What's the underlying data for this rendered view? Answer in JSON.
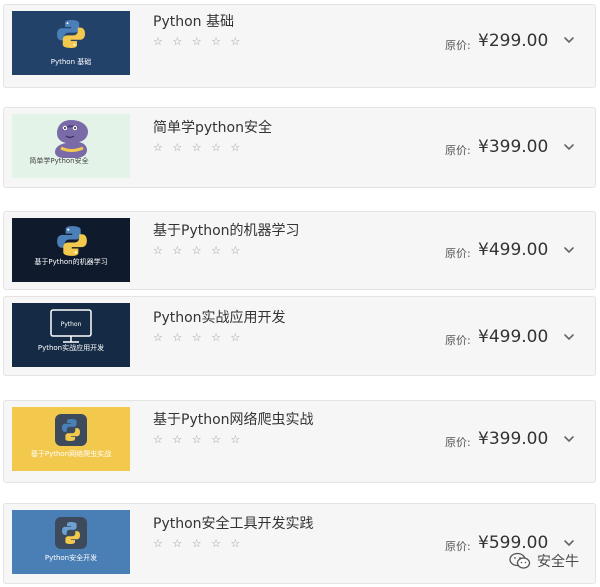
{
  "courses": [
    {
      "title": "Python 基础",
      "stars": "☆ ☆ ☆ ☆ ☆",
      "price_label": "原价:",
      "price": "¥299.00",
      "thumb_caption": "Python 基础",
      "thumb_bg": "#22426a",
      "thumb_fg": "#ffffff",
      "thumb_icon": "python-logo-icon"
    },
    {
      "title": "简单学python安全",
      "stars": "☆ ☆ ☆ ☆ ☆",
      "price_label": "原价:",
      "price": "¥399.00",
      "thumb_caption": "简单学Python安全",
      "thumb_bg": "#e4f3e8",
      "thumb_fg": "#444444",
      "thumb_icon": "python-snake-mascot-icon"
    },
    {
      "title": "基于Python的机器学习",
      "stars": "☆ ☆ ☆ ☆ ☆",
      "price_label": "原价:",
      "price": "¥499.00",
      "thumb_caption": "基于Python的机器学习",
      "thumb_bg": "#0f1a2c",
      "thumb_fg": "#ffffff",
      "thumb_icon": "python-logo-icon"
    },
    {
      "title": "Python实战应用开发",
      "stars": "☆ ☆ ☆ ☆ ☆",
      "price_label": "原价:",
      "price": "¥499.00",
      "thumb_caption": "Python实战应用开发",
      "thumb_screen_text": "Python",
      "thumb_bg": "#152b45",
      "thumb_fg": "#ffffff",
      "thumb_icon": "monitor-icon"
    },
    {
      "title": "基于Python网络爬虫实战",
      "stars": "☆ ☆ ☆ ☆ ☆",
      "price_label": "原价:",
      "price": "¥399.00",
      "thumb_caption": "基于Python网络爬虫实战",
      "thumb_bg": "#f2c94c",
      "thumb_fg": "#ffffff",
      "thumb_icon": "python-badge-icon"
    },
    {
      "title": "Python安全工具开发实践",
      "stars": "☆ ☆ ☆ ☆ ☆",
      "price_label": "原价:",
      "price": "¥599.00",
      "thumb_caption": "Python安全开发",
      "thumb_bg": "#4a7fb5",
      "thumb_fg": "#ffffff",
      "thumb_icon": "python-badge-icon"
    }
  ],
  "watermark": {
    "text": "安全牛",
    "icon": "wechat-icon"
  }
}
